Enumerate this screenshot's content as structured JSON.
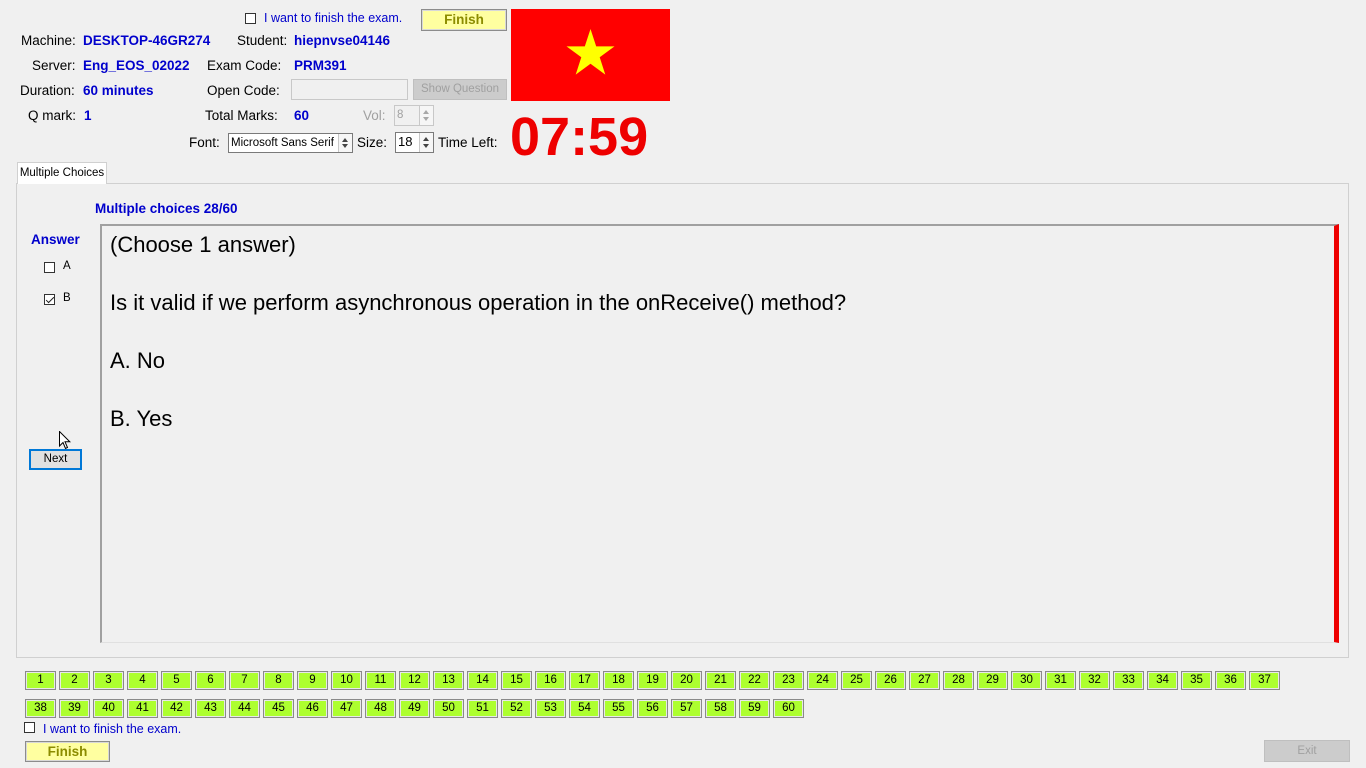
{
  "top": {
    "finish_checkbox_label": "I want to finish the exam.",
    "finish_button": "Finish",
    "machine_label": "Machine:",
    "machine_value": "DESKTOP-46GR274",
    "student_label": "Student:",
    "student_value": "hiepnvse04146",
    "server_label": "Server:",
    "server_value": "Eng_EOS_02022",
    "exam_code_label": "Exam Code:",
    "exam_code_value": "PRM391",
    "duration_label": "Duration:",
    "duration_value": "60 minutes",
    "open_code_label": "Open Code:",
    "open_code_value": "",
    "show_question_button": "Show Question",
    "qmark_label": "Q mark:",
    "qmark_value": "1",
    "total_marks_label": "Total Marks:",
    "total_marks_value": "60",
    "vol_label": "Vol:",
    "vol_value": "8",
    "font_label": "Font:",
    "font_value": "Microsoft Sans Serif",
    "size_label": "Size:",
    "size_value": "18",
    "time_left_label": "Time Left:",
    "timer": "07:59",
    "flag_colors": {
      "field": "#ff0000",
      "star": "#ffff00"
    }
  },
  "tab": {
    "label": "Multiple Choices"
  },
  "question": {
    "progress": "Multiple choices 28/60",
    "answer_heading": "Answer",
    "options": [
      {
        "label": "A",
        "checked": false
      },
      {
        "label": "B",
        "checked": true
      }
    ],
    "next_button": "Next",
    "lines": [
      "(Choose 1 answer)",
      "Is it valid if we perform asynchronous operation in the onReceive() method?",
      "A.  No",
      "B.  Yes"
    ]
  },
  "grid": {
    "row1": [
      "1",
      "2",
      "3",
      "4",
      "5",
      "6",
      "7",
      "8",
      "9",
      "10",
      "11",
      "12",
      "13",
      "14",
      "15",
      "16",
      "17",
      "18",
      "19",
      "20",
      "21",
      "22",
      "23",
      "24",
      "25",
      "26",
      "27",
      "28",
      "29",
      "30",
      "31",
      "32",
      "33",
      "34",
      "35",
      "36",
      "37"
    ],
    "row2": [
      "38",
      "39",
      "40",
      "41",
      "42",
      "43",
      "44",
      "45",
      "46",
      "47",
      "48",
      "49",
      "50",
      "51",
      "52",
      "53",
      "54",
      "55",
      "56",
      "57",
      "58",
      "59",
      "60"
    ],
    "button_color": "#adff2f"
  },
  "bottom": {
    "finish_checkbox_label": "I want to finish the exam.",
    "finish_button": "Finish",
    "exit_button": "Exit"
  }
}
